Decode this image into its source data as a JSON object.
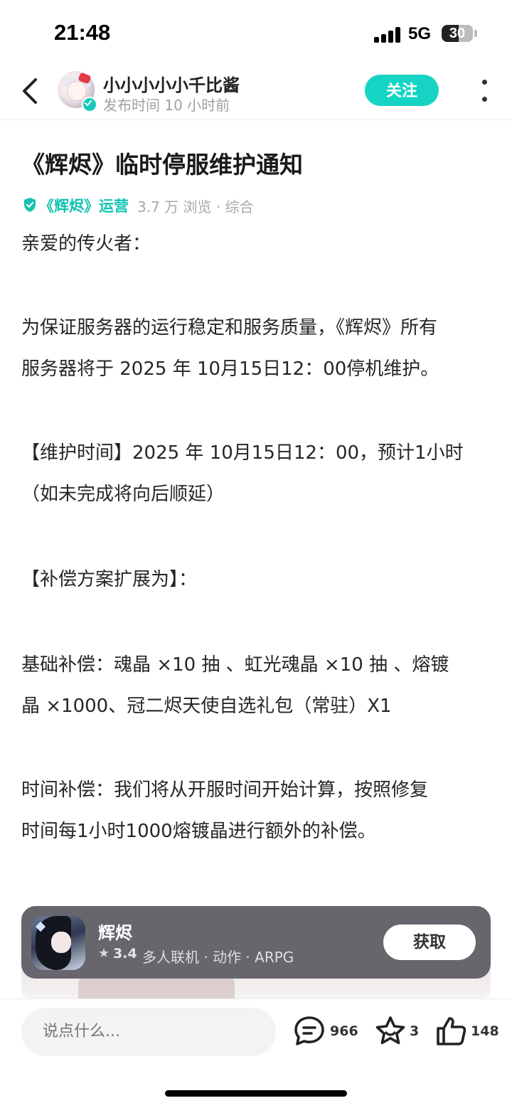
{
  "status_bar": {
    "time": "21:48",
    "network": "5G",
    "battery_percent": "30",
    "battery_level": 0.3
  },
  "header": {
    "author_name": "小小小小小千比酱",
    "post_meta": "发布时间 10 小时前",
    "follow_label": "关注",
    "icons": [
      "back-icon",
      "more-icon",
      "verified-icon"
    ]
  },
  "article": {
    "title": "《辉烬》临时停服维护通知",
    "meta_author": "《辉烬》运营",
    "meta_stats": "3.7 万 浏览 · 综合",
    "accent_color": "#15d4c4",
    "paragraphs": [
      "亲爱的传火者：",
      "为保证服务器的运行稳定和服务质量，《辉烬》所有",
      "服务器将于 2025 年 10月15日12：00停机维护。",
      "【维护时间】2025 年 10月15日12：00，预计1小时",
      "（如未完成将向后顺延）",
      "【补偿方案扩展为】：",
      "基础补偿：魂晶 ×10 抽 、虹光魂晶 ×10 抽 、熔镀",
      "晶 ×1000、冠二烬天使自选礼包（常驻）X1",
      "时间补偿：我们将从开服时间开始计算，按照修复",
      "时间每1小时1000熔镀晶进行额外的补偿。"
    ]
  },
  "app_card": {
    "name": "辉烬",
    "rating": "3.4",
    "tags": "多人联机 · 动作 · ARPG",
    "get_label": "获取"
  },
  "bottom_bar": {
    "comment_placeholder": "说点什么...",
    "comment_count": "966",
    "favorite_count": "3",
    "like_count": "148"
  }
}
